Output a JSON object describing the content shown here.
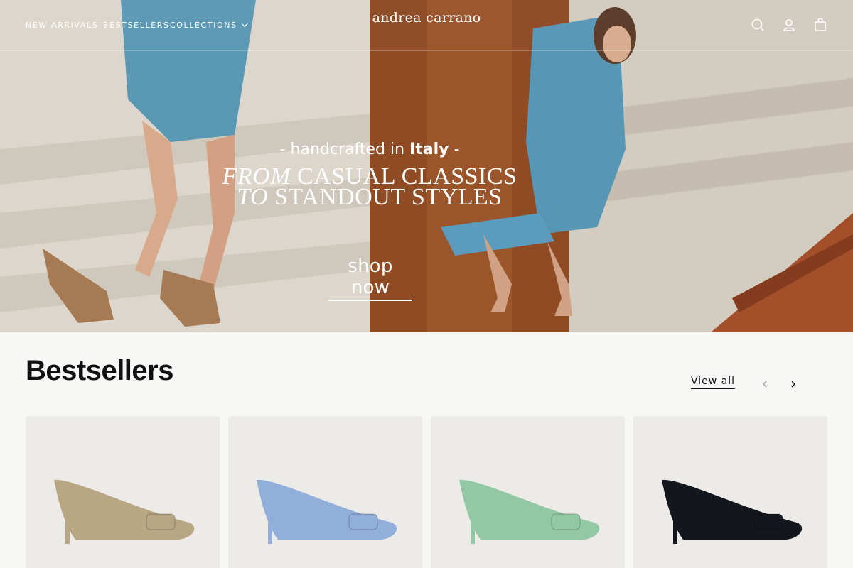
{
  "header": {
    "nav": [
      "NEW ARRIVALS",
      "BESTSELLERS",
      "COLLECTIONS"
    ],
    "logo": "andrea carrano",
    "icons": [
      "search-icon",
      "account-icon",
      "cart-icon"
    ]
  },
  "hero": {
    "tagline_prefix": "- handcrafted in ",
    "tagline_bold": "Italy",
    "tagline_suffix": " -",
    "headline_line1_italic": "FROM",
    "headline_line1_rest": " CASUAL CLASSICS",
    "headline_line2_italic": "TO",
    "headline_line2_rest": " STANDOUT STYLES",
    "cta": "shop now"
  },
  "bestsellers": {
    "title": "Bestsellers",
    "view_all": "View all",
    "products": [
      {
        "color_name": "beige suede",
        "color": "#b8a684"
      },
      {
        "color_name": "light blue suede",
        "color": "#92aedb"
      },
      {
        "color_name": "mint green leather",
        "color": "#92c8a3"
      },
      {
        "color_name": "black suede",
        "color": "#14161d"
      }
    ]
  },
  "colors": {
    "text": "#111111",
    "background": "#f7f7f6",
    "card": "#ecebe8"
  }
}
